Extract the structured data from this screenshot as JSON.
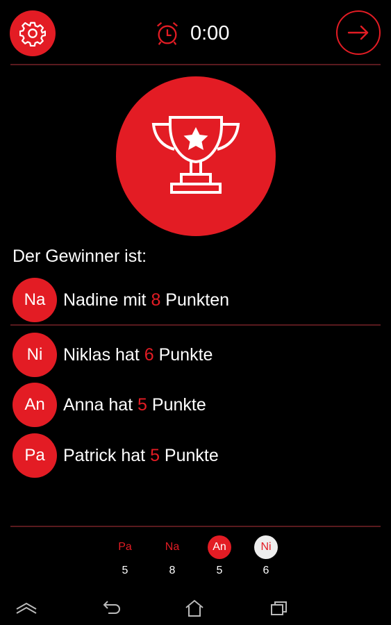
{
  "header": {
    "timer": "0:00",
    "icons": {
      "settings": "gear-icon",
      "alarm": "alarm-clock-icon",
      "next": "arrow-right-icon"
    }
  },
  "trophy": {
    "icon": "trophy-star-icon"
  },
  "winner_heading": "Der Gewinner ist:",
  "winner": {
    "initials": "Na",
    "name": "Nadine",
    "connector": " mit ",
    "points": "8",
    "suffix": " Punkten"
  },
  "others": [
    {
      "initials": "Ni",
      "name": "Niklas",
      "connector": " hat ",
      "points": "6",
      "suffix": " Punkte"
    },
    {
      "initials": "An",
      "name": "Anna",
      "connector": " hat ",
      "points": "5",
      "suffix": " Punkte"
    },
    {
      "initials": "Pa",
      "name": "Patrick",
      "connector": " hat ",
      "points": "5",
      "suffix": " Punkte"
    }
  ],
  "scoreboard": [
    {
      "initials": "Pa",
      "score": "5",
      "state": "normal"
    },
    {
      "initials": "Na",
      "score": "8",
      "state": "normal"
    },
    {
      "initials": "An",
      "score": "5",
      "state": "active"
    },
    {
      "initials": "Ni",
      "score": "6",
      "state": "current"
    }
  ],
  "colors": {
    "accent": "#e31c24",
    "background": "#000000",
    "divider": "#5a1a1e"
  },
  "navbar": {
    "icons": [
      "recent-apps-up-icon",
      "back-icon",
      "home-icon",
      "recents-icon"
    ]
  }
}
